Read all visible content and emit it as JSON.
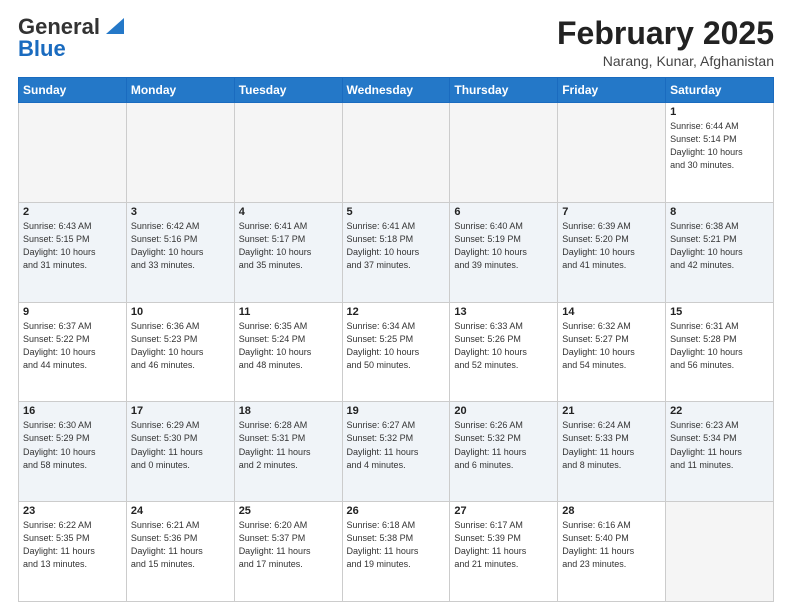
{
  "header": {
    "logo_general": "General",
    "logo_blue": "Blue",
    "month_title": "February 2025",
    "location": "Narang, Kunar, Afghanistan"
  },
  "weekdays": [
    "Sunday",
    "Monday",
    "Tuesday",
    "Wednesday",
    "Thursday",
    "Friday",
    "Saturday"
  ],
  "weeks": [
    [
      {
        "day": "",
        "info": ""
      },
      {
        "day": "",
        "info": ""
      },
      {
        "day": "",
        "info": ""
      },
      {
        "day": "",
        "info": ""
      },
      {
        "day": "",
        "info": ""
      },
      {
        "day": "",
        "info": ""
      },
      {
        "day": "1",
        "info": "Sunrise: 6:44 AM\nSunset: 5:14 PM\nDaylight: 10 hours\nand 30 minutes."
      }
    ],
    [
      {
        "day": "2",
        "info": "Sunrise: 6:43 AM\nSunset: 5:15 PM\nDaylight: 10 hours\nand 31 minutes."
      },
      {
        "day": "3",
        "info": "Sunrise: 6:42 AM\nSunset: 5:16 PM\nDaylight: 10 hours\nand 33 minutes."
      },
      {
        "day": "4",
        "info": "Sunrise: 6:41 AM\nSunset: 5:17 PM\nDaylight: 10 hours\nand 35 minutes."
      },
      {
        "day": "5",
        "info": "Sunrise: 6:41 AM\nSunset: 5:18 PM\nDaylight: 10 hours\nand 37 minutes."
      },
      {
        "day": "6",
        "info": "Sunrise: 6:40 AM\nSunset: 5:19 PM\nDaylight: 10 hours\nand 39 minutes."
      },
      {
        "day": "7",
        "info": "Sunrise: 6:39 AM\nSunset: 5:20 PM\nDaylight: 10 hours\nand 41 minutes."
      },
      {
        "day": "8",
        "info": "Sunrise: 6:38 AM\nSunset: 5:21 PM\nDaylight: 10 hours\nand 42 minutes."
      }
    ],
    [
      {
        "day": "9",
        "info": "Sunrise: 6:37 AM\nSunset: 5:22 PM\nDaylight: 10 hours\nand 44 minutes."
      },
      {
        "day": "10",
        "info": "Sunrise: 6:36 AM\nSunset: 5:23 PM\nDaylight: 10 hours\nand 46 minutes."
      },
      {
        "day": "11",
        "info": "Sunrise: 6:35 AM\nSunset: 5:24 PM\nDaylight: 10 hours\nand 48 minutes."
      },
      {
        "day": "12",
        "info": "Sunrise: 6:34 AM\nSunset: 5:25 PM\nDaylight: 10 hours\nand 50 minutes."
      },
      {
        "day": "13",
        "info": "Sunrise: 6:33 AM\nSunset: 5:26 PM\nDaylight: 10 hours\nand 52 minutes."
      },
      {
        "day": "14",
        "info": "Sunrise: 6:32 AM\nSunset: 5:27 PM\nDaylight: 10 hours\nand 54 minutes."
      },
      {
        "day": "15",
        "info": "Sunrise: 6:31 AM\nSunset: 5:28 PM\nDaylight: 10 hours\nand 56 minutes."
      }
    ],
    [
      {
        "day": "16",
        "info": "Sunrise: 6:30 AM\nSunset: 5:29 PM\nDaylight: 10 hours\nand 58 minutes."
      },
      {
        "day": "17",
        "info": "Sunrise: 6:29 AM\nSunset: 5:30 PM\nDaylight: 11 hours\nand 0 minutes."
      },
      {
        "day": "18",
        "info": "Sunrise: 6:28 AM\nSunset: 5:31 PM\nDaylight: 11 hours\nand 2 minutes."
      },
      {
        "day": "19",
        "info": "Sunrise: 6:27 AM\nSunset: 5:32 PM\nDaylight: 11 hours\nand 4 minutes."
      },
      {
        "day": "20",
        "info": "Sunrise: 6:26 AM\nSunset: 5:32 PM\nDaylight: 11 hours\nand 6 minutes."
      },
      {
        "day": "21",
        "info": "Sunrise: 6:24 AM\nSunset: 5:33 PM\nDaylight: 11 hours\nand 8 minutes."
      },
      {
        "day": "22",
        "info": "Sunrise: 6:23 AM\nSunset: 5:34 PM\nDaylight: 11 hours\nand 11 minutes."
      }
    ],
    [
      {
        "day": "23",
        "info": "Sunrise: 6:22 AM\nSunset: 5:35 PM\nDaylight: 11 hours\nand 13 minutes."
      },
      {
        "day": "24",
        "info": "Sunrise: 6:21 AM\nSunset: 5:36 PM\nDaylight: 11 hours\nand 15 minutes."
      },
      {
        "day": "25",
        "info": "Sunrise: 6:20 AM\nSunset: 5:37 PM\nDaylight: 11 hours\nand 17 minutes."
      },
      {
        "day": "26",
        "info": "Sunrise: 6:18 AM\nSunset: 5:38 PM\nDaylight: 11 hours\nand 19 minutes."
      },
      {
        "day": "27",
        "info": "Sunrise: 6:17 AM\nSunset: 5:39 PM\nDaylight: 11 hours\nand 21 minutes."
      },
      {
        "day": "28",
        "info": "Sunrise: 6:16 AM\nSunset: 5:40 PM\nDaylight: 11 hours\nand 23 minutes."
      },
      {
        "day": "",
        "info": ""
      }
    ]
  ]
}
